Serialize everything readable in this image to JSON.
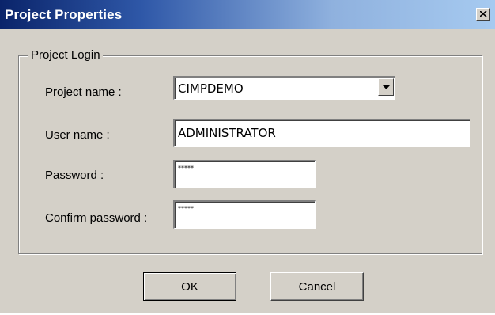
{
  "window": {
    "title": "Project Properties",
    "close_icon": "close-icon"
  },
  "project_login": {
    "legend": "Project Login",
    "project_name_label": "Project name :",
    "project_name_value": "CIMPDEMO",
    "user_name_label": "User name :",
    "user_name_value": "ADMINISTRATOR",
    "password_label": "Password :",
    "password_value": "*****",
    "confirm_password_label": "Confirm password :",
    "confirm_password_value": "*****"
  },
  "buttons": {
    "ok_label": "OK",
    "cancel_label": "Cancel"
  },
  "colors": {
    "face": "#d4d0c8",
    "title_start": "#0a246a",
    "title_end": "#a6caf0"
  }
}
